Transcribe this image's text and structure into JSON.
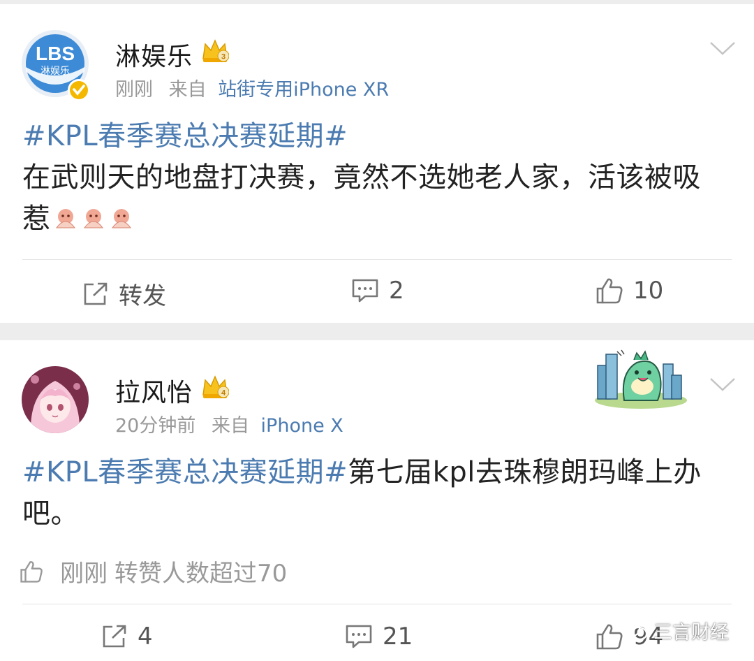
{
  "posts": [
    {
      "avatar_text": "LBS",
      "avatar_subtext": "淋娱乐",
      "username": "淋娱乐",
      "member_level": "3",
      "time": "刚刚",
      "from_prefix": "来自",
      "source": "站街专用iPhone XR",
      "hashtag": "#KPL春季赛总决赛延期#",
      "text": "在武则天的地盘打决赛，竟然不选她老人家，活该被吸惹",
      "emoji_count": 3,
      "actions": {
        "repost": "转发",
        "comments": "2",
        "likes": "10"
      }
    },
    {
      "username": "拉风怡",
      "member_level": "4",
      "time": "20分钟前",
      "from_prefix": "来自",
      "source": "iPhone X",
      "hashtag": "#KPL春季赛总决赛延期#",
      "text": "第七届kpl去珠穆朗玛峰上办吧。",
      "liked_time": "刚刚",
      "liked_text": "转赞人数超过70",
      "actions": {
        "reposts": "4",
        "comments": "21",
        "likes": "94"
      }
    }
  ],
  "watermark": "三言财经",
  "colors": {
    "link": "#4b7bb0",
    "gold": "#f5b800",
    "meta": "#999999",
    "background": "#ededed"
  }
}
